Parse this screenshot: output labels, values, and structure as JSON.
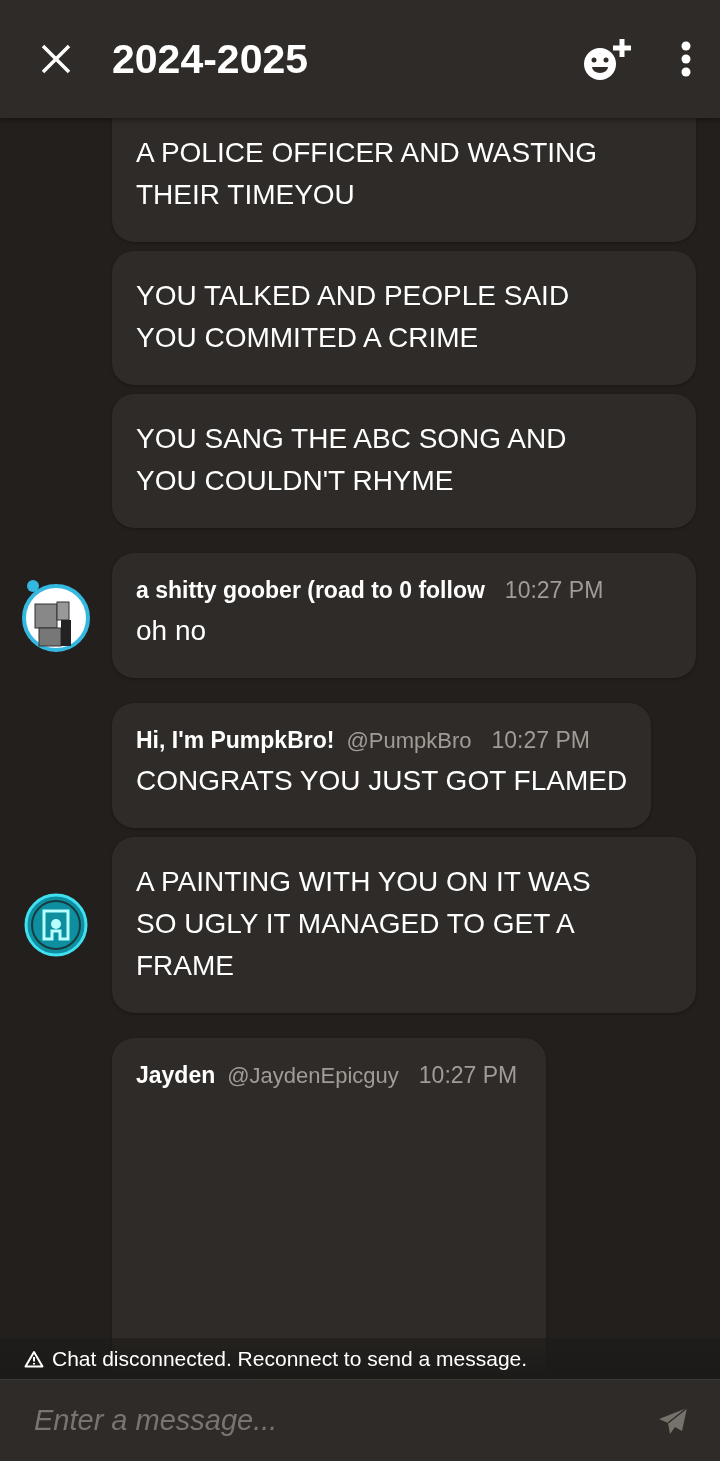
{
  "header": {
    "title": "2024-2025"
  },
  "groups": [
    {
      "messages": [
        {
          "kind": "text",
          "text": "A POLICE OFFICER AND WASTING THEIR TIMEYOU"
        },
        {
          "kind": "text",
          "text": "YOU TALKED AND PEOPLE SAID YOU COMMITED A CRIME"
        },
        {
          "kind": "text",
          "text": "YOU SANG THE ABC SONG AND YOU COULDN'T RHYME"
        }
      ]
    },
    {
      "avatar": {
        "kind": "figure"
      },
      "author": "a shitty goober (road to 0 follow",
      "time": "10:27 PM",
      "messages": [
        {
          "kind": "text",
          "text": "oh no"
        }
      ]
    },
    {
      "avatar": {
        "kind": "emblem"
      },
      "author": "Hi, I'm PumpkBro!",
      "handle": "@PumpkBro",
      "time": "10:27 PM",
      "messages": [
        {
          "kind": "text",
          "text": "CONGRATS YOU JUST GOT FLAMED"
        },
        {
          "kind": "text",
          "text": "A PAINTING WITH YOU ON IT WAS SO UGLY IT MANAGED TO GET A FRAME"
        }
      ]
    },
    {
      "author": "Jayden",
      "handle": "@JaydenEpicguy",
      "time": "10:27 PM",
      "messages": [
        {
          "kind": "attachment"
        }
      ]
    }
  ],
  "notice": "Chat disconnected. Reconnect to send a message.",
  "composer": {
    "placeholder": "Enter a message..."
  }
}
